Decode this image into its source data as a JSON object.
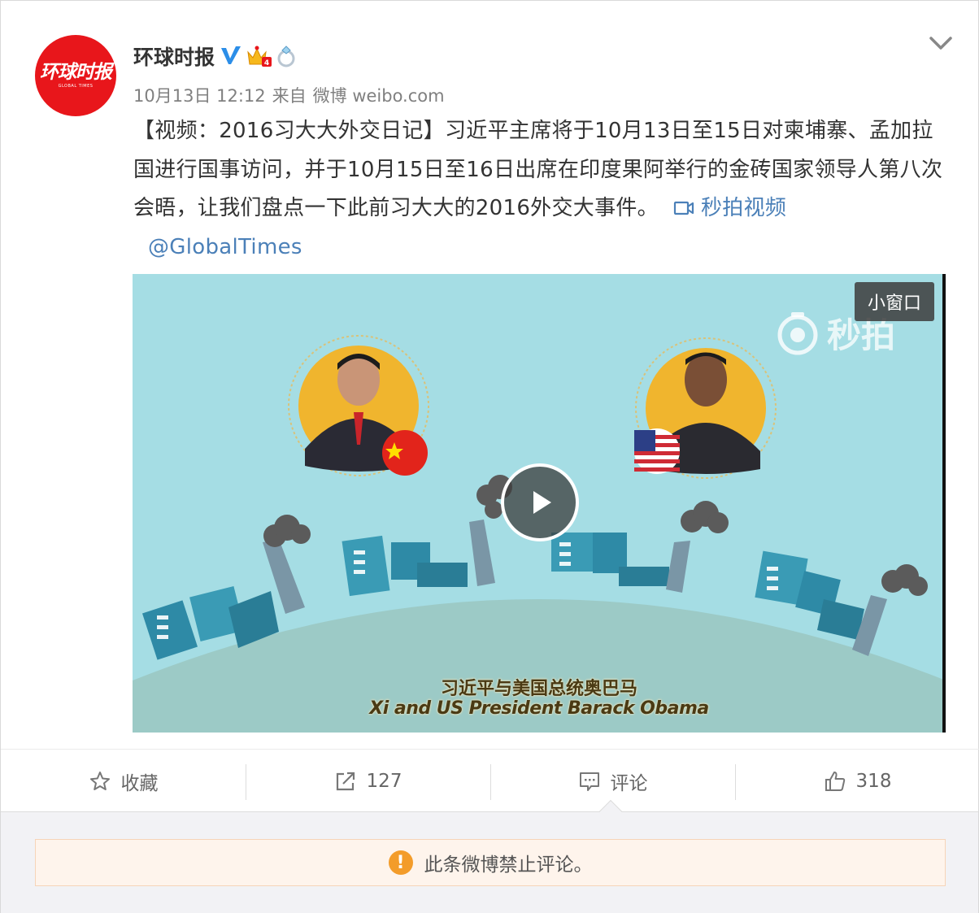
{
  "author": {
    "name": "环球时报",
    "avatar_text": "环球时报",
    "avatar_subtext": "GLOBAL TIMES"
  },
  "meta": {
    "date": "10月13日 12:12",
    "source_prefix": "来自",
    "source": "微博 weibo.com"
  },
  "post": {
    "text_main": "【视频：2016习大大外交日记】习近平主席将于10月13日至15日对柬埔寨、孟加拉国进行国事访问，并于10月15日至16日出席在印度果阿举行的金砖国家领导人第八次会晤，让我们盘点一下此前习大大的2016外交大事件。",
    "video_link_label": "秒拍视频",
    "mention": "@GlobalTimes"
  },
  "video": {
    "mini_window_label": "小窗口",
    "watermark": "秒拍",
    "caption_zh": "习近平与美国总统奥巴马",
    "caption_en": "Xi and US President Barack Obama"
  },
  "actions": {
    "favorite_label": "收藏",
    "repost_count": "127",
    "comment_label": "评论",
    "like_count": "318"
  },
  "comments": {
    "disabled_notice": "此条微博禁止评论。"
  },
  "colors": {
    "brand_red": "#e8161b",
    "link_blue": "#4b80b8",
    "video_sky": "#a5dde4",
    "warning_orange": "#f39c2a"
  }
}
